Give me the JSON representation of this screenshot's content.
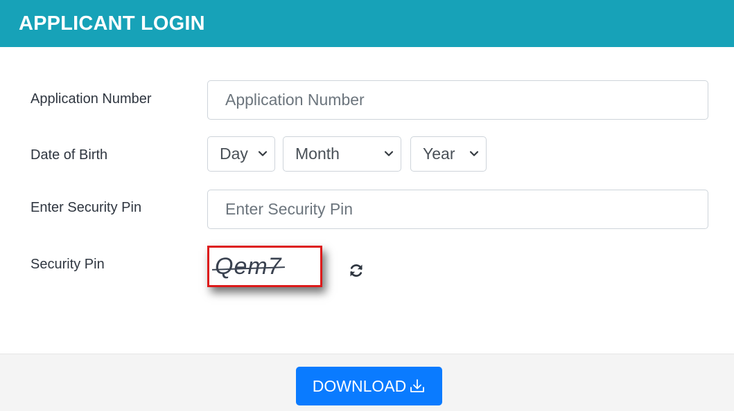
{
  "header": {
    "title": "APPLICANT LOGIN"
  },
  "form": {
    "application_number": {
      "label": "Application Number",
      "placeholder": "Application Number",
      "value": ""
    },
    "date_of_birth": {
      "label": "Date of Birth",
      "day": {
        "selected": "Day"
      },
      "month": {
        "selected": "Month"
      },
      "year": {
        "selected": "Year"
      }
    },
    "security_pin_input": {
      "label": "Enter Security Pin",
      "placeholder": "Enter Security Pin",
      "value": ""
    },
    "security_pin": {
      "label": "Security Pin",
      "captcha": "Qem7",
      "refresh_icon": "refresh-icon"
    }
  },
  "footer": {
    "download_label": "DOWNLOAD",
    "download_icon": "download-icon"
  },
  "colors": {
    "header_bg": "#17a2b8",
    "button_bg": "#0a7bff",
    "captcha_border": "#dd1a1a"
  }
}
